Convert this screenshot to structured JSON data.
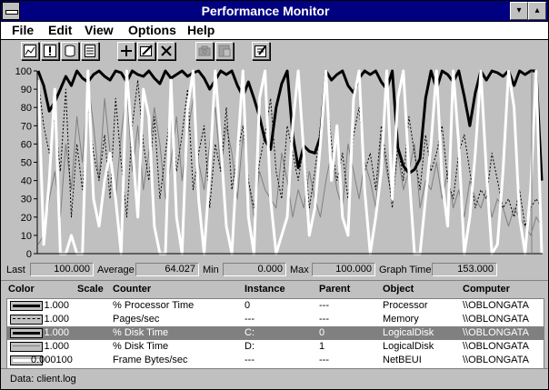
{
  "window": {
    "title": "Performance Monitor"
  },
  "title_buttons": {
    "minimize": "▾",
    "maximize": "▴"
  },
  "menu": [
    "File",
    "Edit",
    "View",
    "Options",
    "Help"
  ],
  "toolbar": {
    "groups": [
      [
        "chart-view-icon",
        "alert-view-icon",
        "log-view-icon",
        "report-view-icon"
      ],
      [
        "add-counter-icon",
        "edit-counter-icon",
        "delete-counter-icon"
      ],
      [
        "update-now-icon",
        "bookmark-icon"
      ],
      [
        "options-icon"
      ]
    ]
  },
  "chart_data": {
    "type": "line",
    "ylim": [
      0,
      100
    ],
    "yticks": [
      0,
      10,
      20,
      30,
      40,
      50,
      60,
      70,
      80,
      90,
      100
    ],
    "x_count": 92,
    "series": [
      {
        "color": "#000000",
        "style": "thick",
        "values": [
          100,
          92,
          78,
          83,
          90,
          97,
          92,
          100,
          96,
          94,
          98,
          100,
          97,
          95,
          100,
          99,
          94,
          100,
          98,
          97,
          100,
          96,
          93,
          100,
          96,
          98,
          100,
          97,
          99,
          100,
          96,
          90,
          95,
          100,
          98,
          100,
          92,
          86,
          94,
          85,
          75,
          62,
          57,
          80,
          93,
          100,
          65,
          47,
          59,
          56,
          55,
          64,
          100,
          95,
          98,
          100,
          92,
          88,
          96,
          100,
          98,
          100,
          94,
          90,
          100,
          58,
          48,
          44,
          46,
          52,
          85,
          100,
          90,
          100,
          98,
          94,
          100,
          86,
          70,
          88,
          100,
          95,
          100,
          99,
          97,
          100,
          92,
          100,
          98,
          100,
          100,
          40
        ]
      },
      {
        "color": "#000000",
        "style": "dashed",
        "values": [
          95,
          70,
          55,
          75,
          45,
          90,
          20,
          60,
          35,
          80,
          55,
          40,
          65,
          30,
          85,
          50,
          20,
          70,
          95,
          60,
          40,
          75,
          30,
          55,
          80,
          45,
          65,
          90,
          35,
          55,
          70,
          25,
          60,
          45,
          80,
          35,
          55,
          70,
          40,
          25,
          50,
          65,
          85,
          45,
          30,
          70,
          55,
          40,
          60,
          25,
          45,
          70,
          95,
          60,
          40,
          55,
          30,
          65,
          80,
          45,
          55,
          35,
          70,
          50,
          25,
          60,
          40,
          75,
          55,
          35,
          65,
          45,
          55,
          70,
          40,
          30,
          55,
          65,
          45,
          25,
          35,
          30,
          55,
          40,
          25,
          30,
          20,
          35,
          15,
          25,
          30,
          25
        ]
      },
      {
        "color": "#808080",
        "style": "thin",
        "values": [
          5,
          10,
          30,
          45,
          20,
          60,
          35,
          75,
          50,
          95,
          70,
          40,
          85,
          55,
          30,
          65,
          90,
          45,
          70,
          35,
          55,
          80,
          60,
          30,
          50,
          75,
          40,
          65,
          85,
          50,
          35,
          60,
          80,
          45,
          70,
          55,
          30,
          65,
          40,
          20,
          45,
          35,
          30,
          25,
          55,
          40,
          20,
          35,
          25,
          45,
          30,
          20,
          40,
          55,
          35,
          25,
          60,
          45,
          30,
          50,
          40,
          25,
          65,
          45,
          30,
          55,
          35,
          45,
          60,
          25,
          40,
          35,
          50,
          30,
          45,
          25,
          35,
          20,
          40,
          30,
          25,
          35,
          20,
          30,
          25,
          15,
          25,
          20,
          15,
          10,
          20,
          15
        ]
      },
      {
        "color": "#ffffff",
        "style": "thick",
        "values": [
          95,
          5,
          40,
          90,
          0,
          0,
          10,
          0,
          0,
          100,
          30,
          15,
          40,
          55,
          30,
          0,
          100,
          60,
          20,
          90,
          75,
          15,
          0,
          0,
          95,
          20,
          0,
          80,
          100,
          30,
          0,
          45,
          100,
          60,
          15,
          0,
          55,
          100,
          20,
          0,
          85,
          100,
          30,
          0,
          10,
          20,
          70,
          100,
          55,
          10,
          25,
          60,
          100,
          40,
          70,
          20,
          10,
          85,
          100,
          35,
          0,
          20,
          45,
          100,
          30,
          85,
          100,
          45,
          0,
          0,
          30,
          60,
          100,
          40,
          15,
          100,
          60,
          0,
          20,
          55,
          100,
          45,
          0,
          5,
          45,
          100,
          80,
          20,
          0,
          35,
          100,
          0
        ]
      }
    ]
  },
  "valuebar": {
    "last_label": "Last",
    "last_value": "100.000",
    "average_label": "Average",
    "average_value": "64.027",
    "min_label": "Min",
    "min_value": "0.000",
    "max_label": "Max",
    "max_value": "100.000",
    "graph_time_label": "Graph Time",
    "graph_time_value": "153.000"
  },
  "legend": {
    "headers": {
      "color": "Color",
      "scale": "Scale",
      "counter": "Counter",
      "instance": "Instance",
      "parent": "Parent",
      "object": "Object",
      "computer": "Computer"
    },
    "rows": [
      {
        "swatch": "#000000",
        "swatch_style": "thick",
        "scale": "1.000",
        "counter": "% Processor Time",
        "instance": "0",
        "parent": "---",
        "object": "Processor",
        "computer": "\\\\OBLONGATA",
        "selected": false
      },
      {
        "swatch": "#000000",
        "swatch_style": "dashed",
        "scale": "1.000",
        "counter": "Pages/sec",
        "instance": "---",
        "parent": "---",
        "object": "Memory",
        "computer": "\\\\OBLONGATA",
        "selected": false
      },
      {
        "swatch": "#000000",
        "swatch_style": "thick",
        "scale": "1.000",
        "counter": "% Disk Time",
        "instance": "C:",
        "parent": "0",
        "object": "LogicalDisk",
        "computer": "\\\\OBLONGATA",
        "selected": true
      },
      {
        "swatch": "#808080",
        "swatch_style": "thin",
        "scale": "1.000",
        "counter": "% Disk Time",
        "instance": "D:",
        "parent": "1",
        "object": "LogicalDisk",
        "computer": "\\\\OBLONGATA",
        "selected": false
      },
      {
        "swatch": "#ffffff",
        "swatch_style": "thick",
        "scale": "0.000100",
        "counter": "Frame Bytes/sec",
        "instance": "---",
        "parent": "---",
        "object": "NetBEUI",
        "computer": "\\\\OBLONGATA",
        "selected": false
      }
    ]
  },
  "status": {
    "text": "Data: client.log"
  }
}
